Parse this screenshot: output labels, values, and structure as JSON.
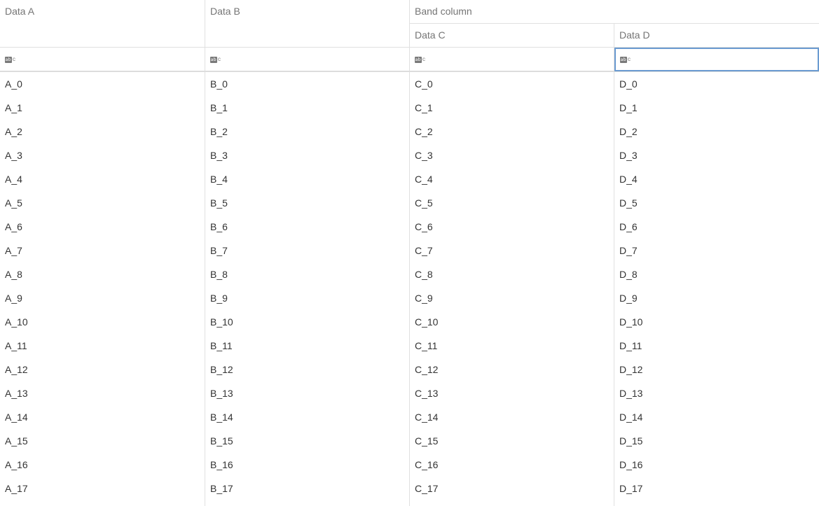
{
  "headers": {
    "data_a": "Data A",
    "data_b": "Data B",
    "band": "Band column",
    "data_c": "Data C",
    "data_d": "Data D"
  },
  "filter_icon": "text-filter-icon",
  "rows": [
    [
      "A_0",
      "B_0",
      "C_0",
      "D_0"
    ],
    [
      "A_1",
      "B_1",
      "C_1",
      "D_1"
    ],
    [
      "A_2",
      "B_2",
      "C_2",
      "D_2"
    ],
    [
      "A_3",
      "B_3",
      "C_3",
      "D_3"
    ],
    [
      "A_4",
      "B_4",
      "C_4",
      "D_4"
    ],
    [
      "A_5",
      "B_5",
      "C_5",
      "D_5"
    ],
    [
      "A_6",
      "B_6",
      "C_6",
      "D_6"
    ],
    [
      "A_7",
      "B_7",
      "C_7",
      "D_7"
    ],
    [
      "A_8",
      "B_8",
      "C_8",
      "D_8"
    ],
    [
      "A_9",
      "B_9",
      "C_9",
      "D_9"
    ],
    [
      "A_10",
      "B_10",
      "C_10",
      "D_10"
    ],
    [
      "A_11",
      "B_11",
      "C_11",
      "D_11"
    ],
    [
      "A_12",
      "B_12",
      "C_12",
      "D_12"
    ],
    [
      "A_13",
      "B_13",
      "C_13",
      "D_13"
    ],
    [
      "A_14",
      "B_14",
      "C_14",
      "D_14"
    ],
    [
      "A_15",
      "B_15",
      "C_15",
      "D_15"
    ],
    [
      "A_16",
      "B_16",
      "C_16",
      "D_16"
    ],
    [
      "A_17",
      "B_17",
      "C_17",
      "D_17"
    ]
  ],
  "colors": {
    "focus_border": "#6b9bd1",
    "grid_line": "#e0e0e0",
    "header_text": "#757575",
    "cell_text": "#333333"
  }
}
